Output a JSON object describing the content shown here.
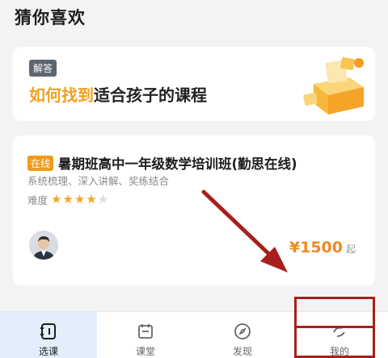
{
  "section_title": "猜你喜欢",
  "answer_card": {
    "tag": "解答",
    "title_highlight": "如何找到",
    "title_rest": "适合孩子的课程"
  },
  "course_card": {
    "tag": "在线",
    "title": "暑期班高中一年级数学培训班(勤思在线)",
    "subtitle": "系统梳理、深入讲解、奖练结合",
    "difficulty_label": "难度",
    "difficulty_rating": 4,
    "difficulty_max": 5,
    "price": "¥1500",
    "price_suffix": "起"
  },
  "tabbar": {
    "tabs": [
      {
        "label": "选课",
        "icon": "course-select-icon",
        "active": true
      },
      {
        "label": "课堂",
        "icon": "calendar-icon",
        "active": false
      },
      {
        "label": "发现",
        "icon": "compass-icon",
        "active": false
      },
      {
        "label": "我的",
        "icon": "profile-icon",
        "active": false
      }
    ]
  },
  "colors": {
    "accent_orange": "#f29a1b",
    "price_orange": "#f08a1f",
    "annotation_red": "#a8201b",
    "active_tab_bg": "#e2eefb"
  }
}
